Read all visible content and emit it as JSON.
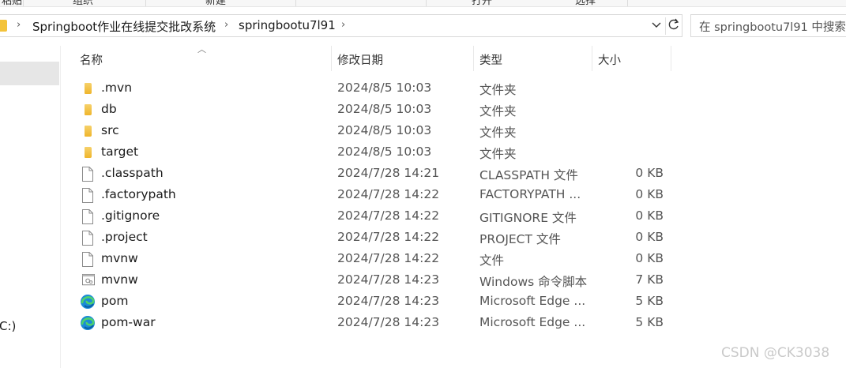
{
  "ribbon": {
    "groups": [
      "粘贴",
      "组织",
      "新建",
      "打开",
      "选择"
    ]
  },
  "address_bar": {
    "crumbs": [
      "Springboot作业在线提交批改系统",
      "springbootu7l91"
    ]
  },
  "search": {
    "placeholder": "在 springbootu7l91 中搜索"
  },
  "nav": {
    "drive_label": "C:)"
  },
  "columns": {
    "name": "名称",
    "date": "修改日期",
    "type": "类型",
    "size": "大小"
  },
  "files": [
    {
      "name": ".mvn",
      "date": "2024/8/5 10:03",
      "type": "文件夹",
      "size": "",
      "icon": "folder-icon"
    },
    {
      "name": "db",
      "date": "2024/8/5 10:03",
      "type": "文件夹",
      "size": "",
      "icon": "folder-icon"
    },
    {
      "name": "src",
      "date": "2024/8/5 10:03",
      "type": "文件夹",
      "size": "",
      "icon": "folder-icon"
    },
    {
      "name": "target",
      "date": "2024/8/5 10:03",
      "type": "文件夹",
      "size": "",
      "icon": "folder-icon"
    },
    {
      "name": ".classpath",
      "date": "2024/7/28 14:21",
      "type": "CLASSPATH 文件",
      "size": "0 KB",
      "icon": "file-icon"
    },
    {
      "name": ".factorypath",
      "date": "2024/7/28 14:22",
      "type": "FACTORYPATH ...",
      "size": "0 KB",
      "icon": "file-icon"
    },
    {
      "name": ".gitignore",
      "date": "2024/7/28 14:22",
      "type": "GITIGNORE 文件",
      "size": "0 KB",
      "icon": "file-icon"
    },
    {
      "name": ".project",
      "date": "2024/7/28 14:22",
      "type": "PROJECT 文件",
      "size": "0 KB",
      "icon": "file-icon"
    },
    {
      "name": "mvnw",
      "date": "2024/7/28 14:22",
      "type": "文件",
      "size": "0 KB",
      "icon": "file-icon"
    },
    {
      "name": "mvnw",
      "date": "2024/7/28 14:23",
      "type": "Windows 命令脚本",
      "size": "7 KB",
      "icon": "script-icon"
    },
    {
      "name": "pom",
      "date": "2024/7/28 14:23",
      "type": "Microsoft Edge ...",
      "size": "5 KB",
      "icon": "edge-icon"
    },
    {
      "name": "pom-war",
      "date": "2024/7/28 14:23",
      "type": "Microsoft Edge ...",
      "size": "5 KB",
      "icon": "edge-icon"
    }
  ],
  "watermark": "CSDN @CK3038"
}
